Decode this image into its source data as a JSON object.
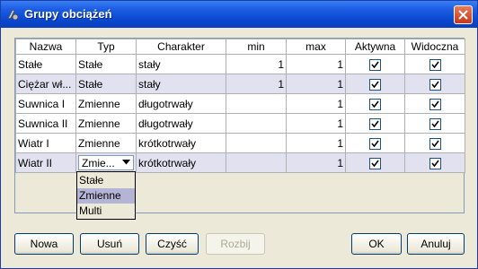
{
  "window": {
    "title": "Grupy obciążeń"
  },
  "table": {
    "headers": [
      "Nazwa",
      "Typ",
      "Charakter",
      "min",
      "max",
      "Aktywna",
      "Widoczna"
    ],
    "rows": [
      {
        "name": "Stałe",
        "type": "Stałe",
        "character": "stały",
        "min": "1",
        "max": "1",
        "active": true,
        "visible": true
      },
      {
        "name": "Ciężar wł...",
        "type": "Stałe",
        "character": "stały",
        "min": "1",
        "max": "1",
        "active": true,
        "visible": true
      },
      {
        "name": "Suwnica I",
        "type": "Zmienne",
        "character": "długotrwały",
        "min": "",
        "max": "1",
        "active": true,
        "visible": true
      },
      {
        "name": "Suwnica II",
        "type": "Zmienne",
        "character": "długotrwały",
        "min": "",
        "max": "1",
        "active": true,
        "visible": true
      },
      {
        "name": "Wiatr I",
        "type": "Zmienne",
        "character": "krótkotrwały",
        "min": "",
        "max": "1",
        "active": true,
        "visible": true
      },
      {
        "name": "Wiatr II",
        "type": "Zmie...",
        "character": "krótkotrwały",
        "min": "",
        "max": "1",
        "active": true,
        "visible": true
      }
    ]
  },
  "dropdown": {
    "options": [
      "Stałe",
      "Zmienne",
      "Multi"
    ],
    "highlighted": "Zmienne"
  },
  "buttons": {
    "new": "Nowa",
    "delete": "Usuń",
    "clear": "Czyść",
    "split": "Rozbij",
    "ok": "OK",
    "cancel": "Anuluj"
  },
  "colors": {
    "titlebar": "#0a48d0",
    "selected_row": "#e1e1f0",
    "highlight": "#b4b4d6"
  }
}
